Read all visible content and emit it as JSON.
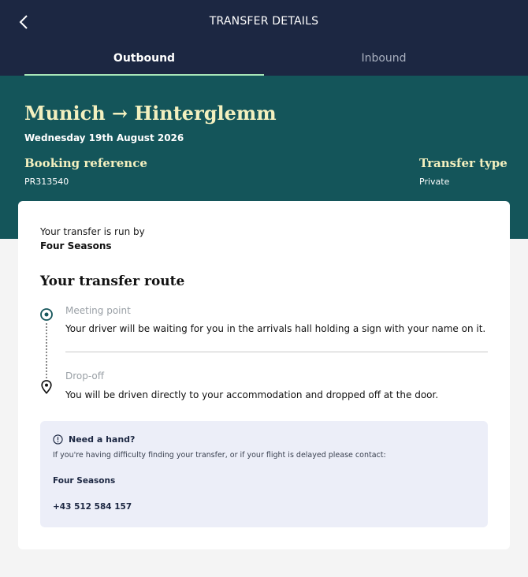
{
  "header": {
    "title": "TRANSFER DETAILS",
    "back_icon": "chevron-left-icon"
  },
  "tabs": [
    {
      "label": "Outbound",
      "active": true
    },
    {
      "label": "Inbound",
      "active": false
    }
  ],
  "transfer": {
    "route": "Munich → Hinterglemm",
    "date": "Wednesday 19th August 2026",
    "booking_reference_label": "Booking reference",
    "booking_reference": "PR313540",
    "transfer_type_label": "Transfer type",
    "transfer_type": "Private"
  },
  "card": {
    "run_by_label": "Your transfer is run by",
    "operator": "Four Seasons",
    "route_heading": "Your transfer route",
    "steps": [
      {
        "label": "Meeting point",
        "text": "Your driver will be waiting for you in the arrivals hall holding a sign with your name on it.",
        "icon": "target-icon"
      },
      {
        "label": "Drop-off",
        "text": "You will be driven directly to your accommodation and dropped off at the door.",
        "icon": "map-pin-icon"
      }
    ]
  },
  "help": {
    "title": "Need a hand?",
    "text": "If you're having difficulty finding your transfer, or if your flight is delayed please contact:",
    "company": "Four Seasons",
    "phone": "+43 512 584 157",
    "icon": "info-icon"
  },
  "colors": {
    "header_bg": "#1c2742",
    "hero_bg": "#14555a",
    "accent_yellow": "#f3f0bf",
    "tab_underline": "#a8e6b8",
    "help_bg": "#eceef8"
  }
}
